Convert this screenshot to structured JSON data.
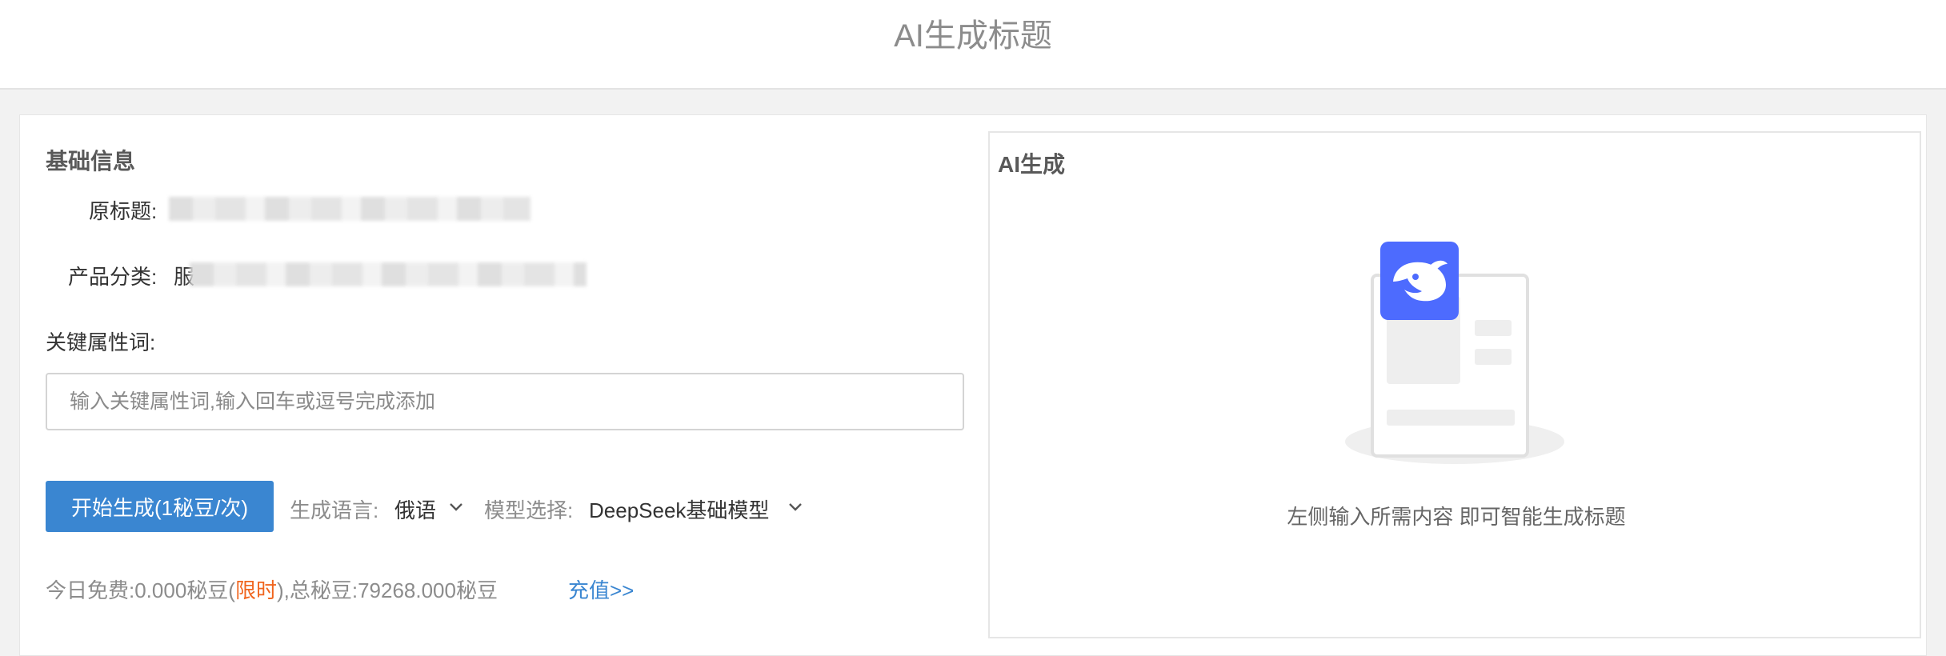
{
  "page": {
    "title": "AI生成标题"
  },
  "basic_info": {
    "section_title": "基础信息",
    "original_title_label": "原标题:",
    "category_label": "产品分类:",
    "category_value_prefix": "服",
    "keywords_label": "关键属性词:",
    "keywords_input": {
      "value": "",
      "placeholder": "输入关键属性词,输入回车或逗号完成添加"
    }
  },
  "controls": {
    "generate_button": "开始生成(1秘豆/次)",
    "language_label": "生成语言:",
    "language_value": "俄语",
    "model_label": "模型选择:",
    "model_value": "DeepSeek基础模型"
  },
  "balance": {
    "prefix": "今日免费:0.000秘豆(",
    "limited": "限时",
    "suffix": "),总秘豆:79268.000秘豆",
    "recharge_link": "充值>>"
  },
  "ai_panel": {
    "title": "AI生成",
    "empty_hint": "左侧输入所需内容 即可智能生成标题",
    "logo_icon": "deepseek-whale-icon",
    "brand_color": "#4d6bfe"
  },
  "colors": {
    "primary": "#3a86d1",
    "accent": "#f0651e"
  }
}
